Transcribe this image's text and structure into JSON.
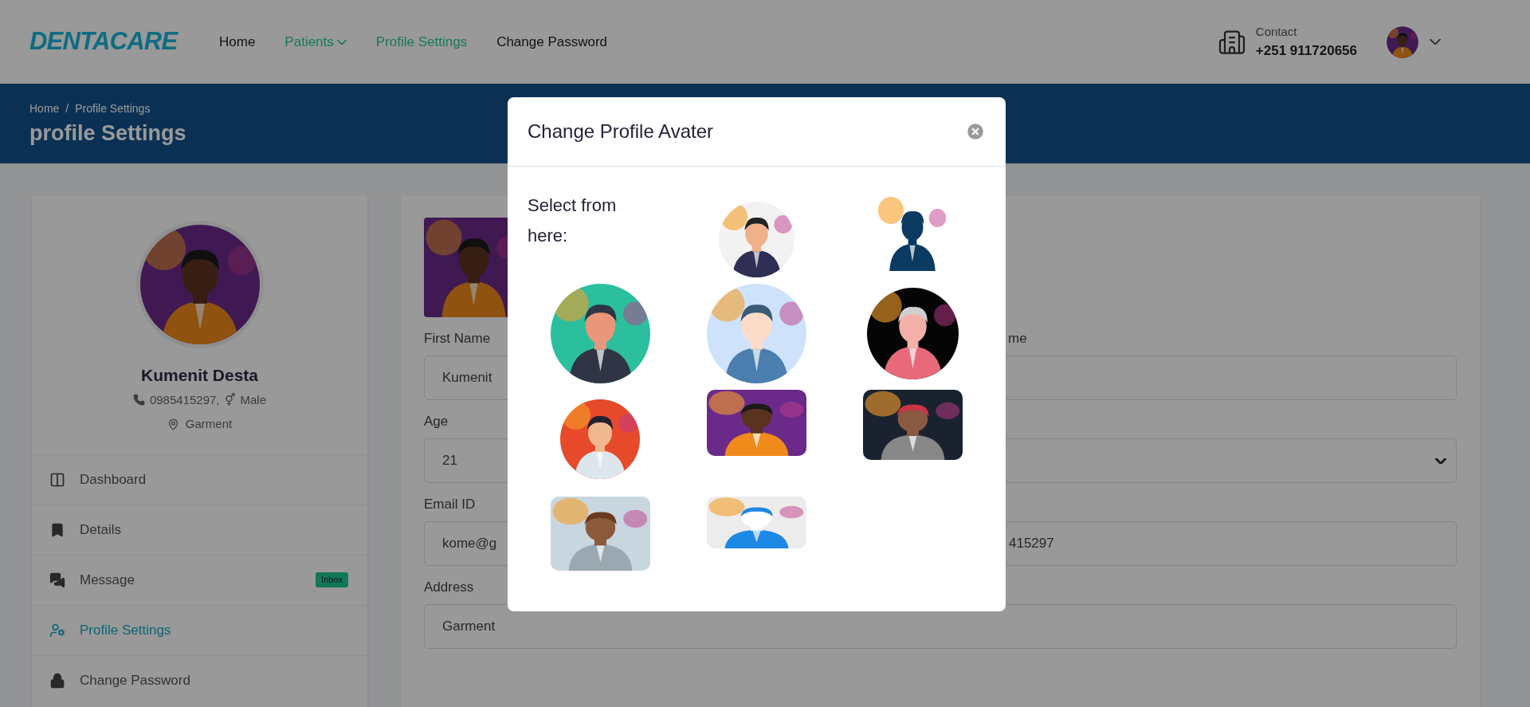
{
  "header": {
    "logo": "DENTACARE",
    "nav": [
      {
        "label": "Home",
        "active": false,
        "dropdown": false
      },
      {
        "label": "Patients",
        "active": true,
        "dropdown": true
      },
      {
        "label": "Profile Settings",
        "active": true,
        "dropdown": false
      },
      {
        "label": "Change Password",
        "active": false,
        "dropdown": false
      }
    ],
    "contact": {
      "label": "Contact",
      "phone": "+251 911720656"
    }
  },
  "banner": {
    "breadcrumb": [
      "Home",
      "Profile Settings"
    ],
    "separator": "/",
    "title": "profile Settings"
  },
  "sidebar": {
    "name": "Kumenit Desta",
    "phone": "0985415297,",
    "gender_symbol": "⚥",
    "gender": "Male",
    "address": "Garment",
    "menu": [
      {
        "label": "Dashboard",
        "selected": false
      },
      {
        "label": "Details",
        "selected": false
      },
      {
        "label": "Message",
        "selected": false,
        "badge": "Inbox"
      },
      {
        "label": "Profile Settings",
        "selected": true
      },
      {
        "label": "Change Password",
        "selected": false
      }
    ]
  },
  "form": {
    "rows": [
      {
        "left": {
          "label": "First Name",
          "value": "Kumenit"
        },
        "right": {
          "label": "me",
          "kind": "text"
        }
      },
      {
        "left": {
          "label": "Age",
          "value": "21"
        },
        "right": {
          "kind": "select"
        }
      },
      {
        "left": {
          "label": "Email ID",
          "value": "kome@g"
        },
        "right": {
          "value": "415297",
          "kind": "text"
        }
      }
    ],
    "address": {
      "label": "Address",
      "value": "Garment"
    }
  },
  "modal": {
    "title": "Change Profile Avater",
    "prompt": "Select from here:"
  }
}
